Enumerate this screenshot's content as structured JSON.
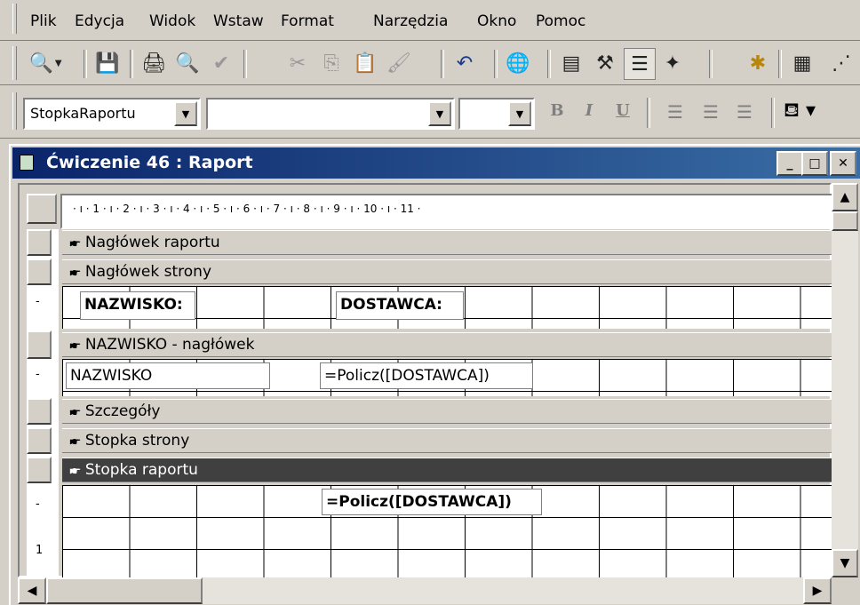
{
  "menubar": {
    "items": [
      "Plik",
      "Edycja",
      "Widok",
      "Wstaw",
      "Format",
      "Narzędzia",
      "Okno",
      "Pomoc"
    ]
  },
  "toolbar": {
    "buttons": [
      {
        "icon": "print-preview-icon",
        "glyph": "🔍"
      },
      {
        "icon": "save-icon",
        "glyph": "💾"
      },
      {
        "icon": "print-icon",
        "glyph": "🖨"
      },
      {
        "icon": "preview-icon",
        "glyph": "🔍"
      },
      {
        "icon": "spelling-icon",
        "glyph": "✔"
      },
      {
        "icon": "cut-icon",
        "glyph": "✂"
      },
      {
        "icon": "copy-icon",
        "glyph": "⎘"
      },
      {
        "icon": "paste-icon",
        "glyph": "📋"
      },
      {
        "icon": "format-painter-icon",
        "glyph": "🖌"
      },
      {
        "icon": "undo-icon",
        "glyph": "↶"
      },
      {
        "icon": "hyperlink-icon",
        "glyph": "🌐"
      },
      {
        "icon": "field-list-icon",
        "glyph": "▤"
      },
      {
        "icon": "toolbox-icon",
        "glyph": "⚒"
      },
      {
        "icon": "sorting-grouping-icon",
        "glyph": "☰"
      },
      {
        "icon": "autoformat-icon",
        "glyph": "✦"
      },
      {
        "icon": "code-icon",
        "glyph": "✱"
      },
      {
        "icon": "properties-icon",
        "glyph": "▦"
      },
      {
        "icon": "build-icon",
        "glyph": "⋰"
      }
    ]
  },
  "format_toolbar": {
    "object_combo": "StopkaRaportu",
    "font_combo": "",
    "size_combo": "",
    "bold": "B",
    "italic": "I",
    "underline": "U"
  },
  "window": {
    "title": "Ćwiczenie 46 : Raport",
    "minimize": "_",
    "restore": "□",
    "close": "✕"
  },
  "ruler": {
    "text": "· ı · 1 · ı · 2 · ı · 3 · ı · 4 · ı · 5 · ı · 6 · ı · 7 · ı · 8 · ı · 9 · ı · 10 · ı · 11 ·"
  },
  "sections": {
    "report_header": "Nagłówek raportu",
    "page_header": "Nagłówek strony",
    "group_header": "NAZWISKO - nagłówek",
    "detail": "Szczegóły",
    "page_footer": "Stopka strony",
    "report_footer": "Stopka raportu"
  },
  "controls": {
    "label_nazwisko": "NAZWISKO:",
    "label_dostawca": "DOSTAWCA:",
    "field_nazwisko": "NAZWISKO",
    "field_count_group": "=Policz([DOSTAWCA])",
    "field_count_report": "=Policz([DOSTAWCA])"
  },
  "vertical_ruler": {
    "page_header_mark": "-",
    "group_mark": "-",
    "footer_mark_1": "-",
    "footer_mark_2": "1"
  },
  "colors": {
    "title_bar_start": "#0a246a",
    "title_bar_end": "#3a6ea5",
    "active_section": "#404040",
    "face": "#d4d0c8"
  }
}
